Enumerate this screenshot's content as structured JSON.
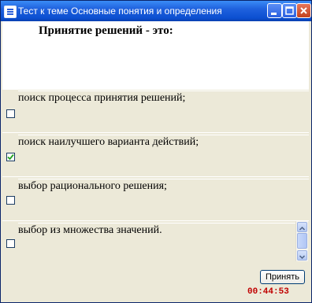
{
  "window": {
    "title": "Тест к теме Основные понятия и определения",
    "buttons": {
      "minimize": "minimize-icon",
      "maximize": "maximize-icon",
      "close": "close-icon"
    }
  },
  "question": {
    "text": "Принятие решений - это:"
  },
  "options": [
    {
      "label": "поиск процесса принятия решений;",
      "checked": false
    },
    {
      "label": " поиск наилучшего варианта действий;",
      "checked": true
    },
    {
      "label": "выбор рационального решения;",
      "checked": false
    },
    {
      "label": "выбор из множества значений.",
      "checked": false
    }
  ],
  "accept_button": {
    "label": "Принять"
  },
  "timer": {
    "value": "00:44:53"
  },
  "colors": {
    "title_bar": "#0b4fd0",
    "panel": "#ece9d8",
    "timer": "#c00000",
    "button_border": "#003c74"
  }
}
